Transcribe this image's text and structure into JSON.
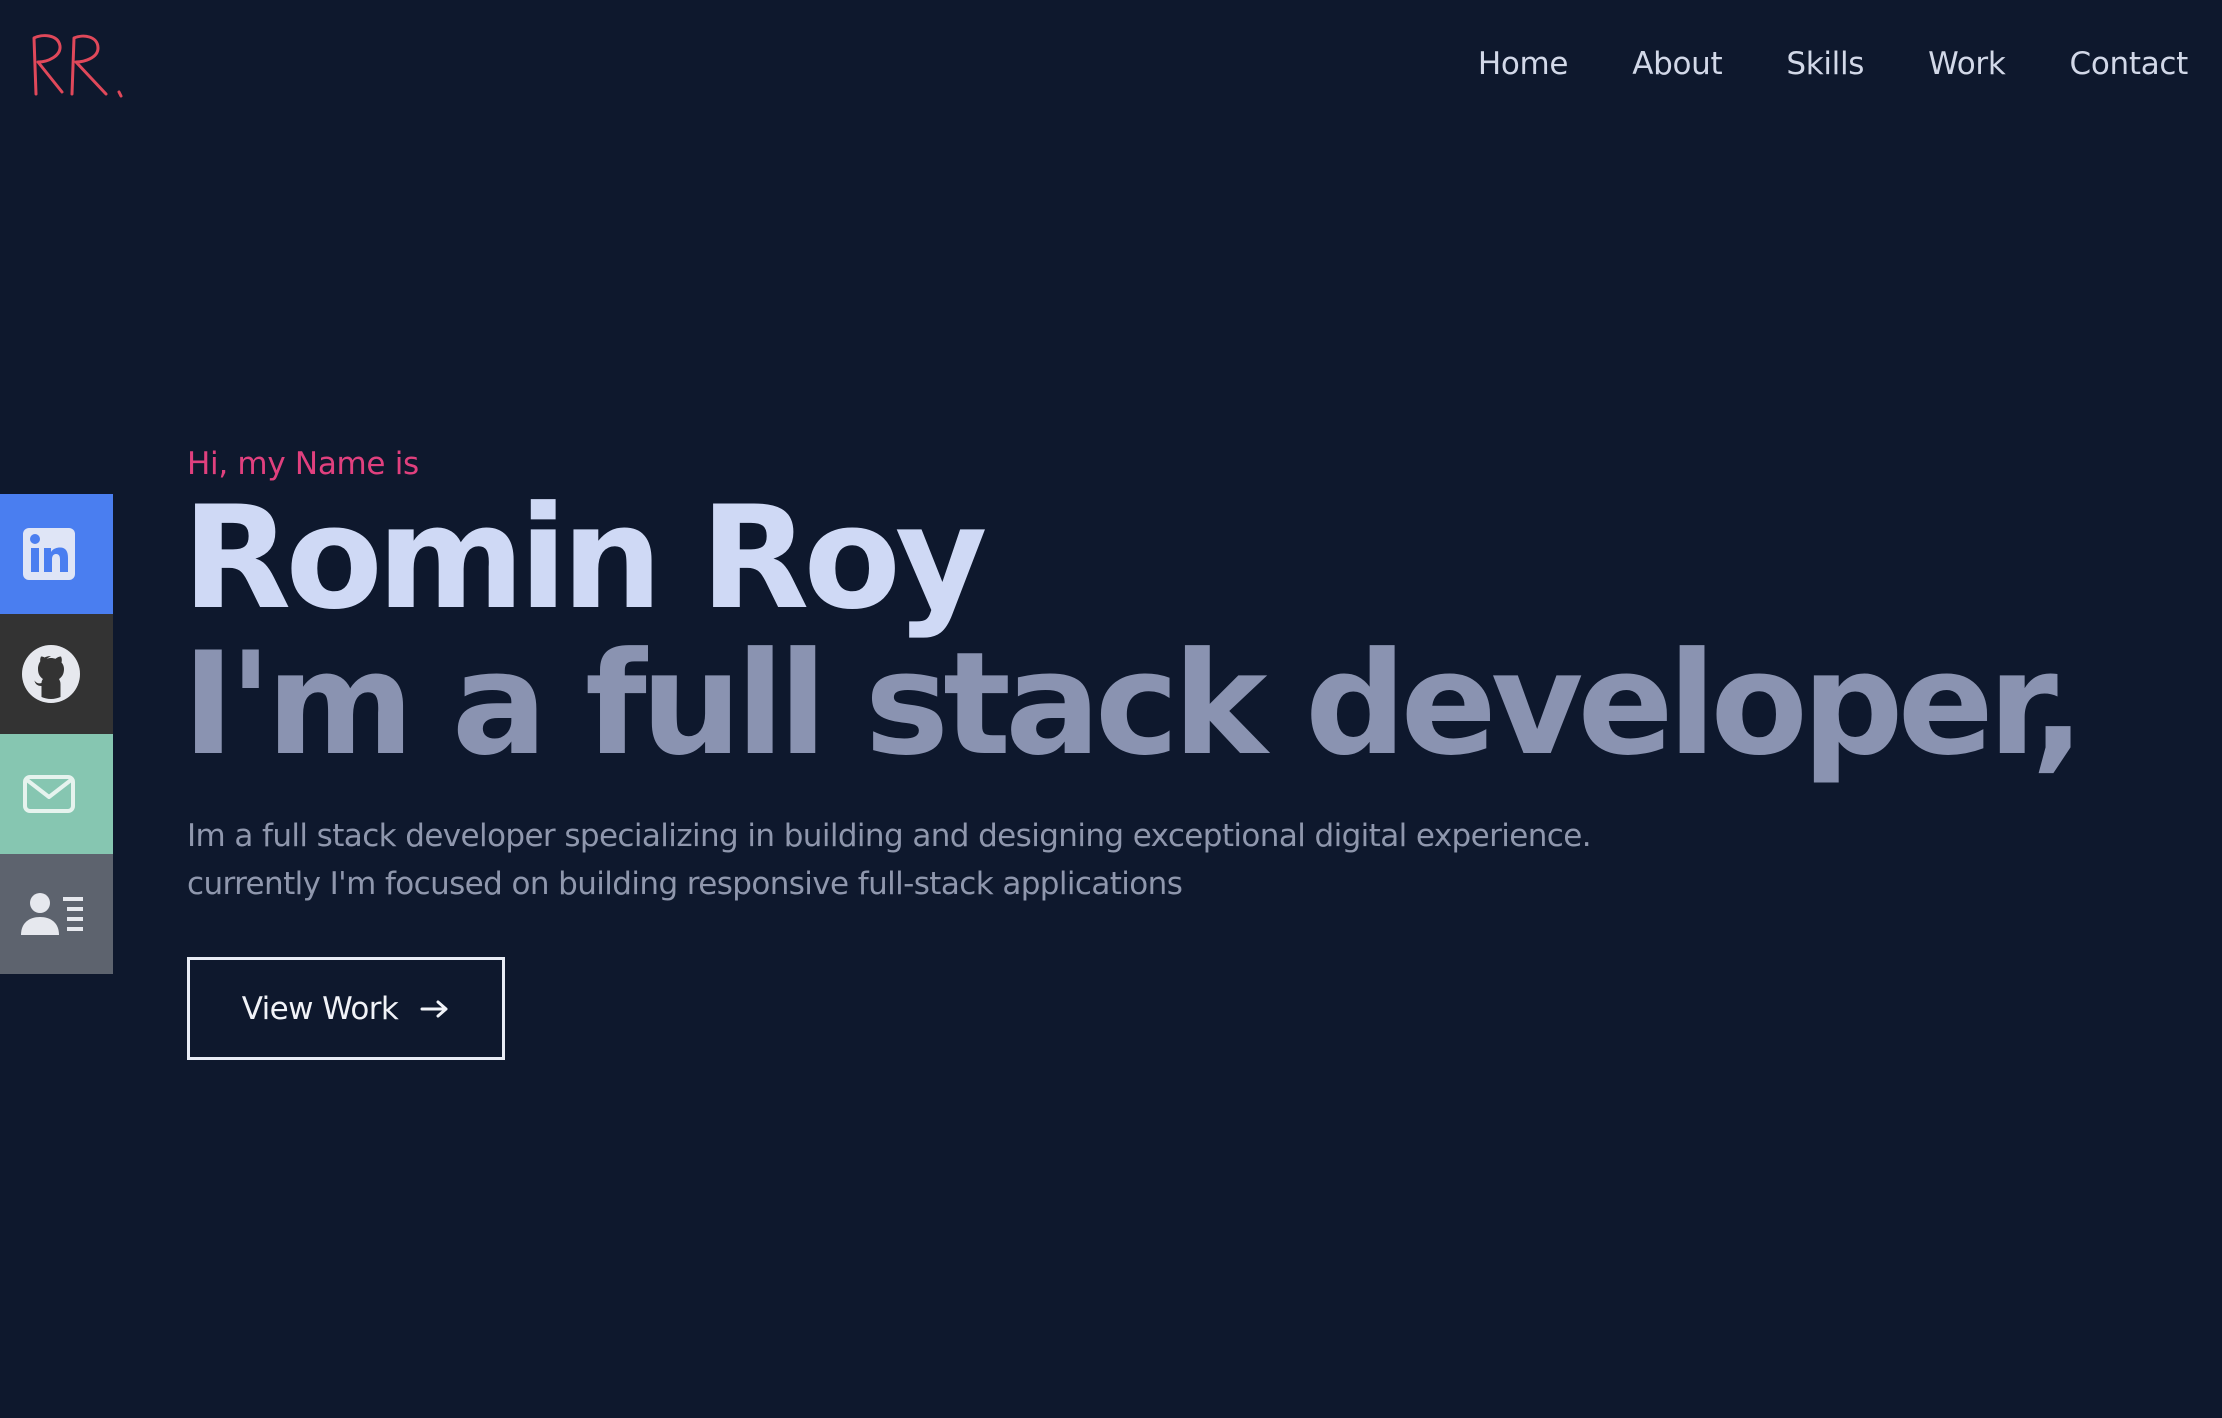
{
  "logo": {
    "text": "RR.",
    "color": "#e0485a"
  },
  "nav": {
    "items": [
      {
        "label": "Home"
      },
      {
        "label": "About"
      },
      {
        "label": "Skills"
      },
      {
        "label": "Work"
      },
      {
        "label": "Contact"
      }
    ]
  },
  "social": {
    "items": [
      {
        "icon": "linkedin-icon",
        "color": "#4a7ef0"
      },
      {
        "icon": "github-icon",
        "color": "#333333"
      },
      {
        "icon": "mail-icon",
        "color": "#86c6b1"
      },
      {
        "icon": "contact-card-icon",
        "color": "#5d636e"
      }
    ]
  },
  "hero": {
    "greeting": "Hi, my Name is",
    "name": "Romin Roy",
    "tagline": "I'm a full stack developer,",
    "description_line1": "Im a full stack developer specializing in building and designing exceptional digital experience.",
    "description_line2": "currently I'm focused on building responsive full-stack applications",
    "button_label": "View Work"
  },
  "colors": {
    "background": "#0e182d",
    "accent_pink": "#e0407e",
    "name": "#cfd9f5",
    "tagline": "#8a93b1"
  }
}
